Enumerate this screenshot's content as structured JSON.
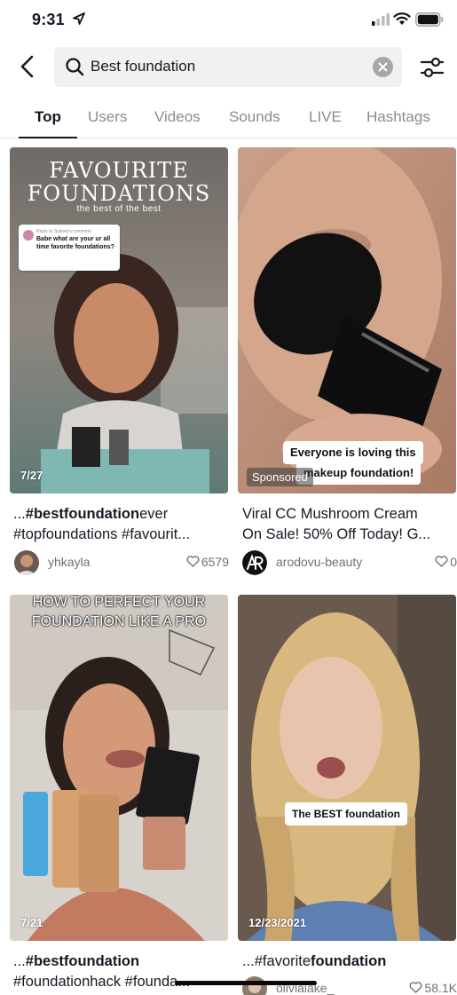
{
  "status": {
    "time": "9:31"
  },
  "search": {
    "query": "Best foundation"
  },
  "tabs": [
    "Top",
    "Users",
    "Videos",
    "Sounds",
    "LIVE",
    "Hashtags"
  ],
  "results": [
    {
      "overlay_title_1": "FAVOURITE",
      "overlay_title_2": "FOUNDATIONS",
      "overlay_subtitle": "the best of the best",
      "comment_reply": "Reply to Sydney's comment",
      "comment_text": "Babe what are your ur all time favorite foundations?",
      "count": "7/27",
      "caption_prefix": "...",
      "caption_bold": "#bestfoundation",
      "caption_rest": "ever",
      "caption_line2": "#topfoundations #favourit...",
      "username": "yhkayla",
      "likes": "6579"
    },
    {
      "overlay_line_1": "Everyone is loving this",
      "overlay_line_2": "makeup foundation!",
      "badge": "Sponsored",
      "caption_line1": "Viral CC Mushroom Cream",
      "caption_line2": "On Sale! 50% Off Today! G...",
      "username": "arodovu-beauty",
      "likes": "0"
    },
    {
      "overlay_line_1": "HOW TO PERFECT YOUR",
      "overlay_line_2": "FOUNDATION LIKE A PRO",
      "count": "7/21",
      "caption_prefix": "...",
      "caption_bold": "#bestfoundation",
      "caption_line2": "#foundationhack #founda..."
    },
    {
      "overlay_line_1": "The BEST foundation",
      "count": "12/23/2021",
      "caption_prefix": "...#favorite",
      "caption_bold": "foundation",
      "username": "oliviaiake_",
      "likes": "58.1K"
    }
  ]
}
